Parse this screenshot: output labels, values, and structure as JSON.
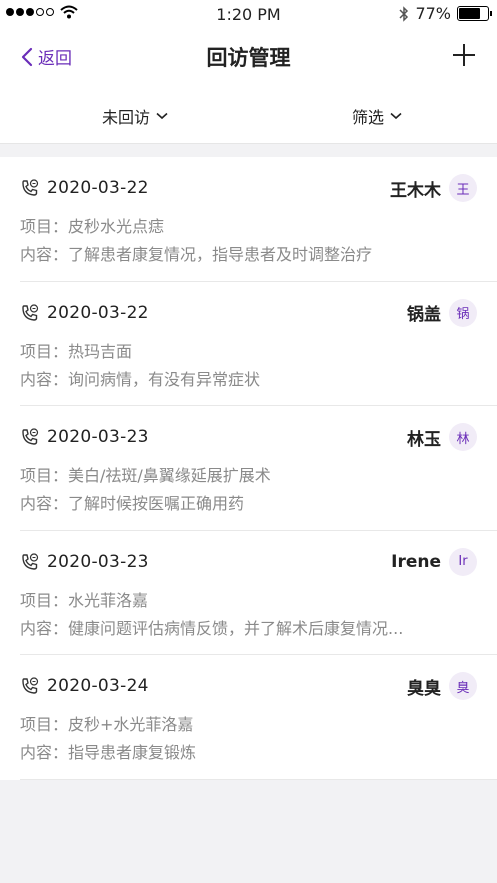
{
  "status": {
    "time": "1:20 PM",
    "battery": "77%",
    "battery_level": 0.77
  },
  "nav": {
    "back_label": "返回",
    "title": "回访管理"
  },
  "filters": {
    "status_label": "未回访",
    "filter_label": "筛选"
  },
  "labels": {
    "project": "项目：",
    "content": "内容："
  },
  "items": [
    {
      "date": "2020-03-22",
      "name": "王木木",
      "avatar": "王",
      "project": "皮秒水光点痣",
      "content": "了解患者康复情况，指导患者及时调整治疗"
    },
    {
      "date": "2020-03-22",
      "name": "锅盖",
      "avatar": "锅",
      "project": "热玛吉面",
      "content": "询问病情，有没有异常症状"
    },
    {
      "date": "2020-03-23",
      "name": "林玉",
      "avatar": "林",
      "project": "美白/祛斑/鼻翼缘延展扩展术",
      "content": "了解时候按医嘱正确用药"
    },
    {
      "date": "2020-03-23",
      "name": "Irene",
      "avatar": "Ir",
      "project": "水光菲洛嘉",
      "content": "健康问题评估病情反馈，并了解术后康复情况..."
    },
    {
      "date": "2020-03-24",
      "name": "臭臭",
      "avatar": "臭",
      "project": "皮秒+水光菲洛嘉",
      "content": "指导患者康复锻炼"
    }
  ]
}
